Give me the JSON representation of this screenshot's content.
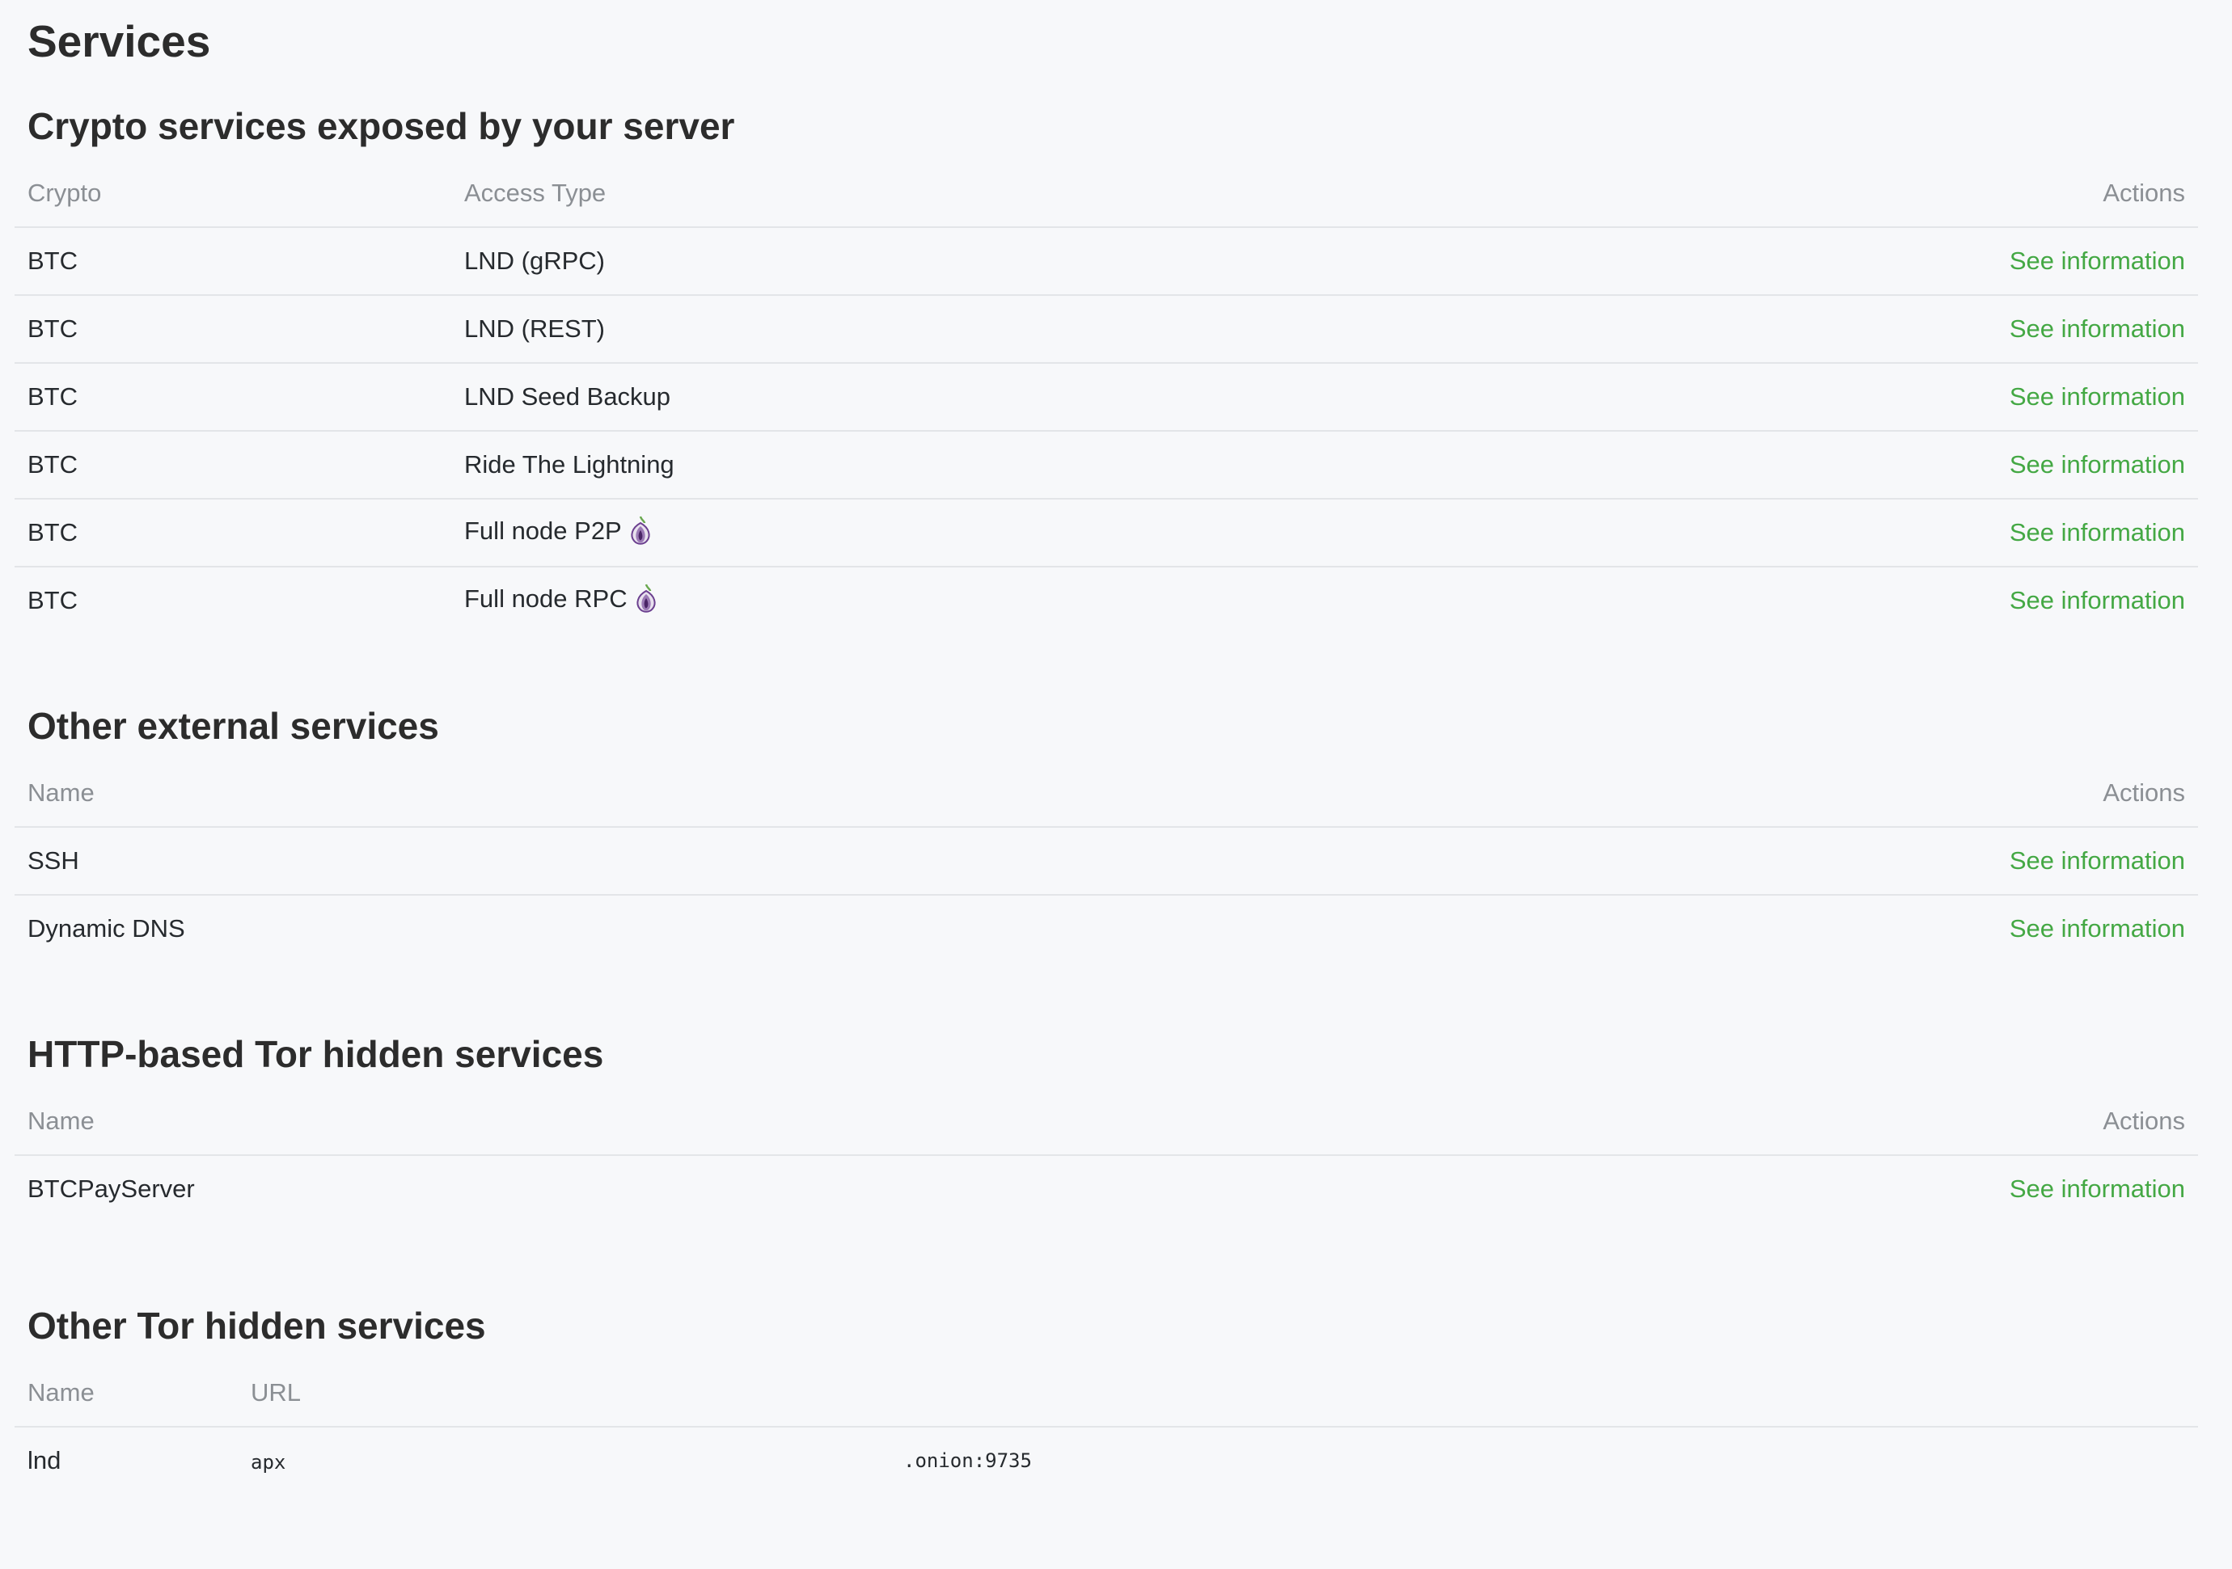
{
  "page": {
    "title": "Services"
  },
  "crypto_services": {
    "title": "Crypto services exposed by your server",
    "columns": [
      "Crypto",
      "Access Type",
      "Actions"
    ],
    "rows": [
      {
        "crypto": "BTC",
        "access_type": "LND (gRPC)",
        "tor": false,
        "action": "See information"
      },
      {
        "crypto": "BTC",
        "access_type": "LND (REST)",
        "tor": false,
        "action": "See information"
      },
      {
        "crypto": "BTC",
        "access_type": "LND Seed Backup",
        "tor": false,
        "action": "See information"
      },
      {
        "crypto": "BTC",
        "access_type": "Ride The Lightning",
        "tor": false,
        "action": "See information"
      },
      {
        "crypto": "BTC",
        "access_type": "Full node P2P",
        "tor": true,
        "tor_icon": "tor-onion-icon",
        "action": "See information"
      },
      {
        "crypto": "BTC",
        "access_type": "Full node RPC",
        "tor": true,
        "tor_icon": "tor-onion-icon",
        "action": "See information"
      }
    ]
  },
  "other_external_services": {
    "title": "Other external services",
    "columns": [
      "Name",
      "Actions"
    ],
    "rows": [
      {
        "name": "SSH",
        "action": "See information"
      },
      {
        "name": "Dynamic DNS",
        "action": "See information"
      }
    ]
  },
  "http_tor_services": {
    "title": "HTTP-based Tor hidden services",
    "columns": [
      "Name",
      "Actions"
    ],
    "rows": [
      {
        "name": "BTCPayServer",
        "action": "See information"
      }
    ]
  },
  "other_tor_services": {
    "title": "Other Tor hidden services",
    "columns": [
      "Name",
      "URL"
    ],
    "rows": [
      {
        "name": "lnd",
        "url_prefix": "apx",
        "url_suffix": ".onion:9735"
      }
    ]
  },
  "colors": {
    "link": "#44a844",
    "header_text": "#8b8f94",
    "background": "#f7f8fa",
    "tor_icon": "#6b3f8f"
  }
}
